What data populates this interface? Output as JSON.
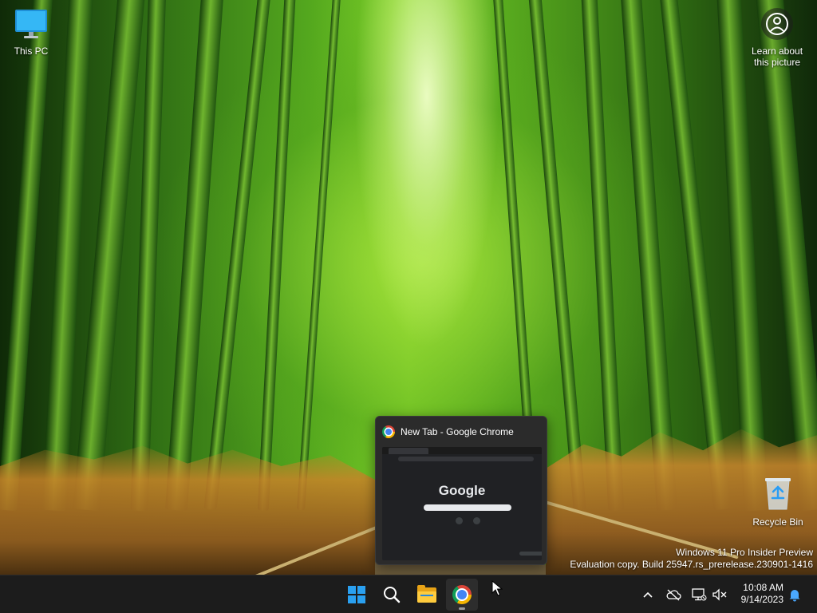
{
  "desktop": {
    "icons": {
      "this_pc": "This PC",
      "learn_about": "Learn about this picture",
      "recycle_bin": "Recycle Bin"
    },
    "watermark": {
      "line1": "Windows 11 Pro Insider Preview",
      "line2": "Evaluation copy. Build 25947.rs_prerelease.230901-1416"
    }
  },
  "task_preview": {
    "title": "New Tab - Google Chrome",
    "thumbnail_logo_text": "Google"
  },
  "taskbar": {
    "apps": [
      "start-icon",
      "search-icon",
      "file-explorer-icon",
      "chrome-icon"
    ],
    "tray_icons": [
      "chevron-up-icon",
      "onedrive-cloud-icon",
      "network-icon",
      "volume-muted-icon",
      "notification-bell-icon"
    ],
    "time": "10:08 AM",
    "date": "9/14/2023"
  },
  "colors": {
    "taskbar_bg": "#1c1c1c",
    "accent_blue": "#2aa0f0",
    "bell_blue": "#4aa8ff"
  }
}
